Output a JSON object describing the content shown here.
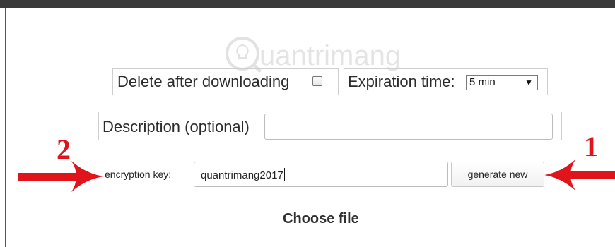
{
  "watermark": {
    "text": "uantrimang"
  },
  "options": {
    "delete_after_label": "Delete after downloading",
    "expiration_label": "Expiration time:",
    "expiration_selected": "5 min"
  },
  "description": {
    "label": "Description (optional)",
    "value": ""
  },
  "encryption": {
    "label": "encryption key:",
    "value": "quantrimang2017",
    "generate_label": "generate new"
  },
  "choose_file_label": "Choose file",
  "annotations": {
    "marker_left": "2",
    "marker_right": "1",
    "color": "#e0141b"
  }
}
